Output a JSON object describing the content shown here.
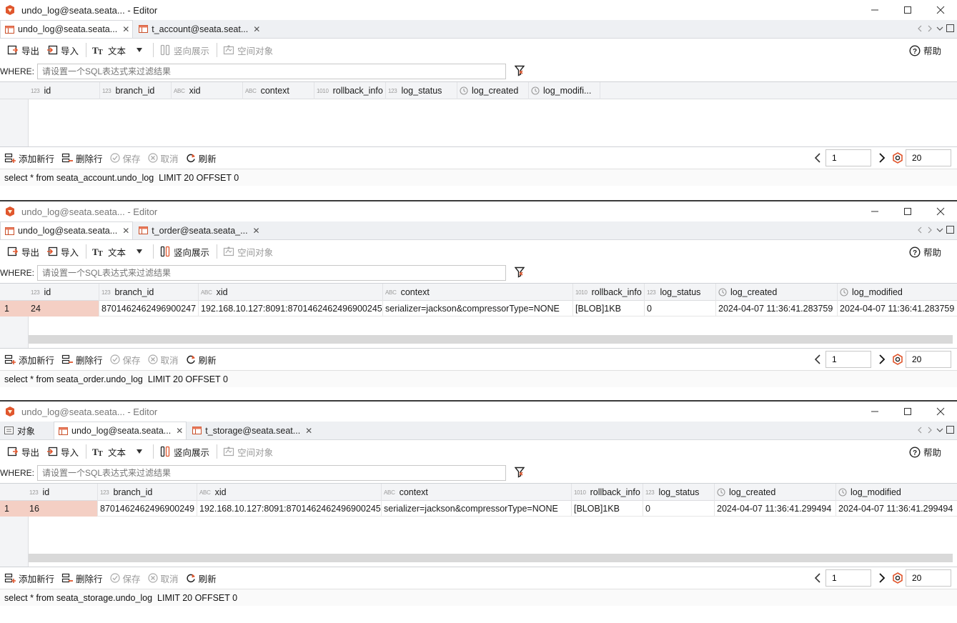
{
  "windows": [
    {
      "title": "undo_log@seata.seata... - Editor",
      "active": true,
      "tabs": [
        {
          "label": "undo_log@seata.seata...",
          "active": true,
          "icon": "table-icon"
        },
        {
          "label": "t_account@seata.seat...",
          "active": false,
          "icon": "table-icon"
        }
      ],
      "toolbar": {
        "export": "导出",
        "import": "导入",
        "text": "文本",
        "vertical": "竖向展示",
        "spatial": "空间对象",
        "help": "帮助"
      },
      "where": {
        "label": "WHERE:",
        "placeholder": "请设置一个SQL表达式来过滤结果"
      },
      "columns": [
        "id",
        "branch_id",
        "xid",
        "context",
        "rollback_info",
        "log_status",
        "log_created",
        "log_modifi..."
      ],
      "rows": [],
      "actions": {
        "add_row": "添加新行",
        "delete_row": "删除行",
        "save": "保存",
        "cancel": "取消",
        "refresh": "刷新"
      },
      "page": "1",
      "limit": "20",
      "status": "select * from seata_account.undo_log  LIMIT 20 OFFSET 0"
    },
    {
      "title": "undo_log@seata.seata... - Editor",
      "active": false,
      "tabs": [
        {
          "label": "undo_log@seata.seata...",
          "active": true,
          "icon": "table-icon"
        },
        {
          "label": "t_order@seata.seata_...",
          "active": false,
          "icon": "table-icon"
        }
      ],
      "toolbar": {
        "export": "导出",
        "import": "导入",
        "text": "文本",
        "vertical": "竖向展示",
        "spatial": "空间对象",
        "help": "帮助"
      },
      "where": {
        "label": "WHERE:",
        "placeholder": "请设置一个SQL表达式来过滤结果"
      },
      "columns": [
        "id",
        "branch_id",
        "xid",
        "context",
        "rollback_info",
        "log_status",
        "log_created",
        "log_modified"
      ],
      "rows": [
        {
          "num": "1",
          "cells": [
            "24",
            "8701462462496900247",
            "192.168.10.127:8091:8701462462496900245",
            "serializer=jackson&compressorType=NONE",
            "[BLOB]1KB",
            "0",
            "2024-04-07 11:36:41.283759",
            "2024-04-07 11:36:41.283759"
          ]
        }
      ],
      "actions": {
        "add_row": "添加新行",
        "delete_row": "删除行",
        "save": "保存",
        "cancel": "取消",
        "refresh": "刷新"
      },
      "page": "1",
      "limit": "20",
      "status": "select * from seata_order.undo_log  LIMIT 20 OFFSET 0"
    },
    {
      "title": "undo_log@seata.seata... - Editor",
      "active": false,
      "tabs": [
        {
          "label": "对象",
          "active": false,
          "icon": "objects-icon"
        },
        {
          "label": "undo_log@seata.seata...",
          "active": true,
          "icon": "table-icon"
        },
        {
          "label": "t_storage@seata.seat...",
          "active": false,
          "icon": "table-icon"
        }
      ],
      "toolbar": {
        "export": "导出",
        "import": "导入",
        "text": "文本",
        "vertical": "竖向展示",
        "spatial": "空间对象",
        "help": "帮助"
      },
      "where": {
        "label": "WHERE:",
        "placeholder": "请设置一个SQL表达式来过滤结果"
      },
      "columns": [
        "id",
        "branch_id",
        "xid",
        "context",
        "rollback_info",
        "log_status",
        "log_created",
        "log_modified"
      ],
      "rows": [
        {
          "num": "1",
          "cells": [
            "16",
            "8701462462496900249",
            "192.168.10.127:8091:8701462462496900245",
            "serializer=jackson&compressorType=NONE",
            "[BLOB]1KB",
            "0",
            "2024-04-07 11:36:41.299494",
            "2024-04-07 11:36:41.299494"
          ]
        }
      ],
      "actions": {
        "add_row": "添加新行",
        "delete_row": "删除行",
        "save": "保存",
        "cancel": "取消",
        "refresh": "刷新"
      },
      "page": "1",
      "limit": "20",
      "status": "select * from seata_storage.undo_log  LIMIT 20 OFFSET 0"
    }
  ],
  "column_type_tags": [
    "123",
    "123",
    "ABC",
    "ABC",
    "1010",
    "123",
    "clock-icon",
    "clock-icon"
  ],
  "colors": {
    "accent": "#e0562d",
    "selected_cell": "#f4cfc4",
    "header_bg": "#f3f4f6"
  }
}
